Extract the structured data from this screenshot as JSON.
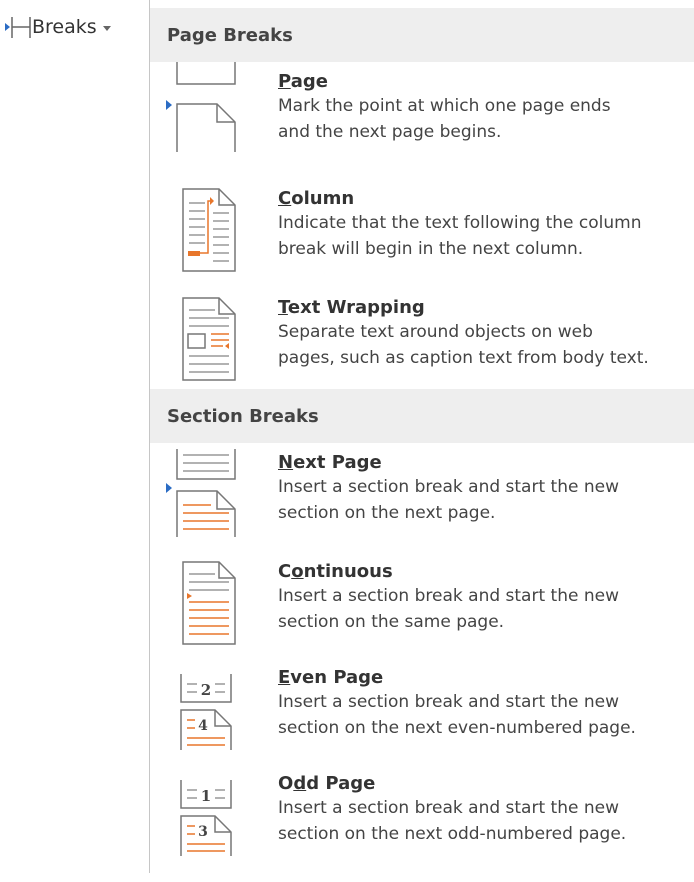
{
  "ribbon": {
    "breaks_label": "Breaks"
  },
  "page_breaks": {
    "header": "Page Breaks",
    "items": [
      {
        "title": "Page",
        "access_key": "P",
        "title_rest": "age",
        "desc1": "Mark the point at which one page ends",
        "desc2": "and the next page begins.",
        "icon": "page-break-icon"
      },
      {
        "title": "Column",
        "access_key": "C",
        "title_rest": "olumn",
        "desc1": "Indicate that the text following the column",
        "desc2": "break will begin in the next column.",
        "icon": "column-break-icon"
      },
      {
        "title": "Text Wrapping",
        "access_key": "T",
        "title_rest": "ext Wrapping",
        "desc1": "Separate text around objects on web",
        "desc2": "pages, such as caption text from body text.",
        "icon": "text-wrapping-icon"
      }
    ]
  },
  "section_breaks": {
    "header": "Section Breaks",
    "items": [
      {
        "title": "Next Page",
        "access_key": "N",
        "title_pre": "",
        "title_rest": "ext Page",
        "desc1": "Insert a section break and start the new",
        "desc2": "section on the next page.",
        "icon": "next-page-icon"
      },
      {
        "title": "Continuous",
        "access_key": "o",
        "title_pre": "C",
        "title_rest": "ntinuous",
        "desc1": "Insert a section break and start the new",
        "desc2": "section on the same page.",
        "icon": "continuous-icon"
      },
      {
        "title": "Even Page",
        "access_key": "E",
        "title_pre": "",
        "title_rest": "ven Page",
        "desc1": "Insert a section break and start the new",
        "desc2": "section on the next even-numbered page.",
        "icon": "even-page-icon",
        "num_top": "2",
        "num_bottom": "4"
      },
      {
        "title": "Odd Page",
        "access_key": "d",
        "title_pre": "O",
        "title_rest": "d Page",
        "desc1": "Insert a section break and start the new",
        "desc2": "section on the next odd-numbered page.",
        "icon": "odd-page-icon",
        "num_top": "1",
        "num_bottom": "3"
      }
    ]
  },
  "colors": {
    "accent_orange": "#e8762b",
    "selection_blue": "#2b6cc4",
    "header_bg": "#eeeeee"
  }
}
